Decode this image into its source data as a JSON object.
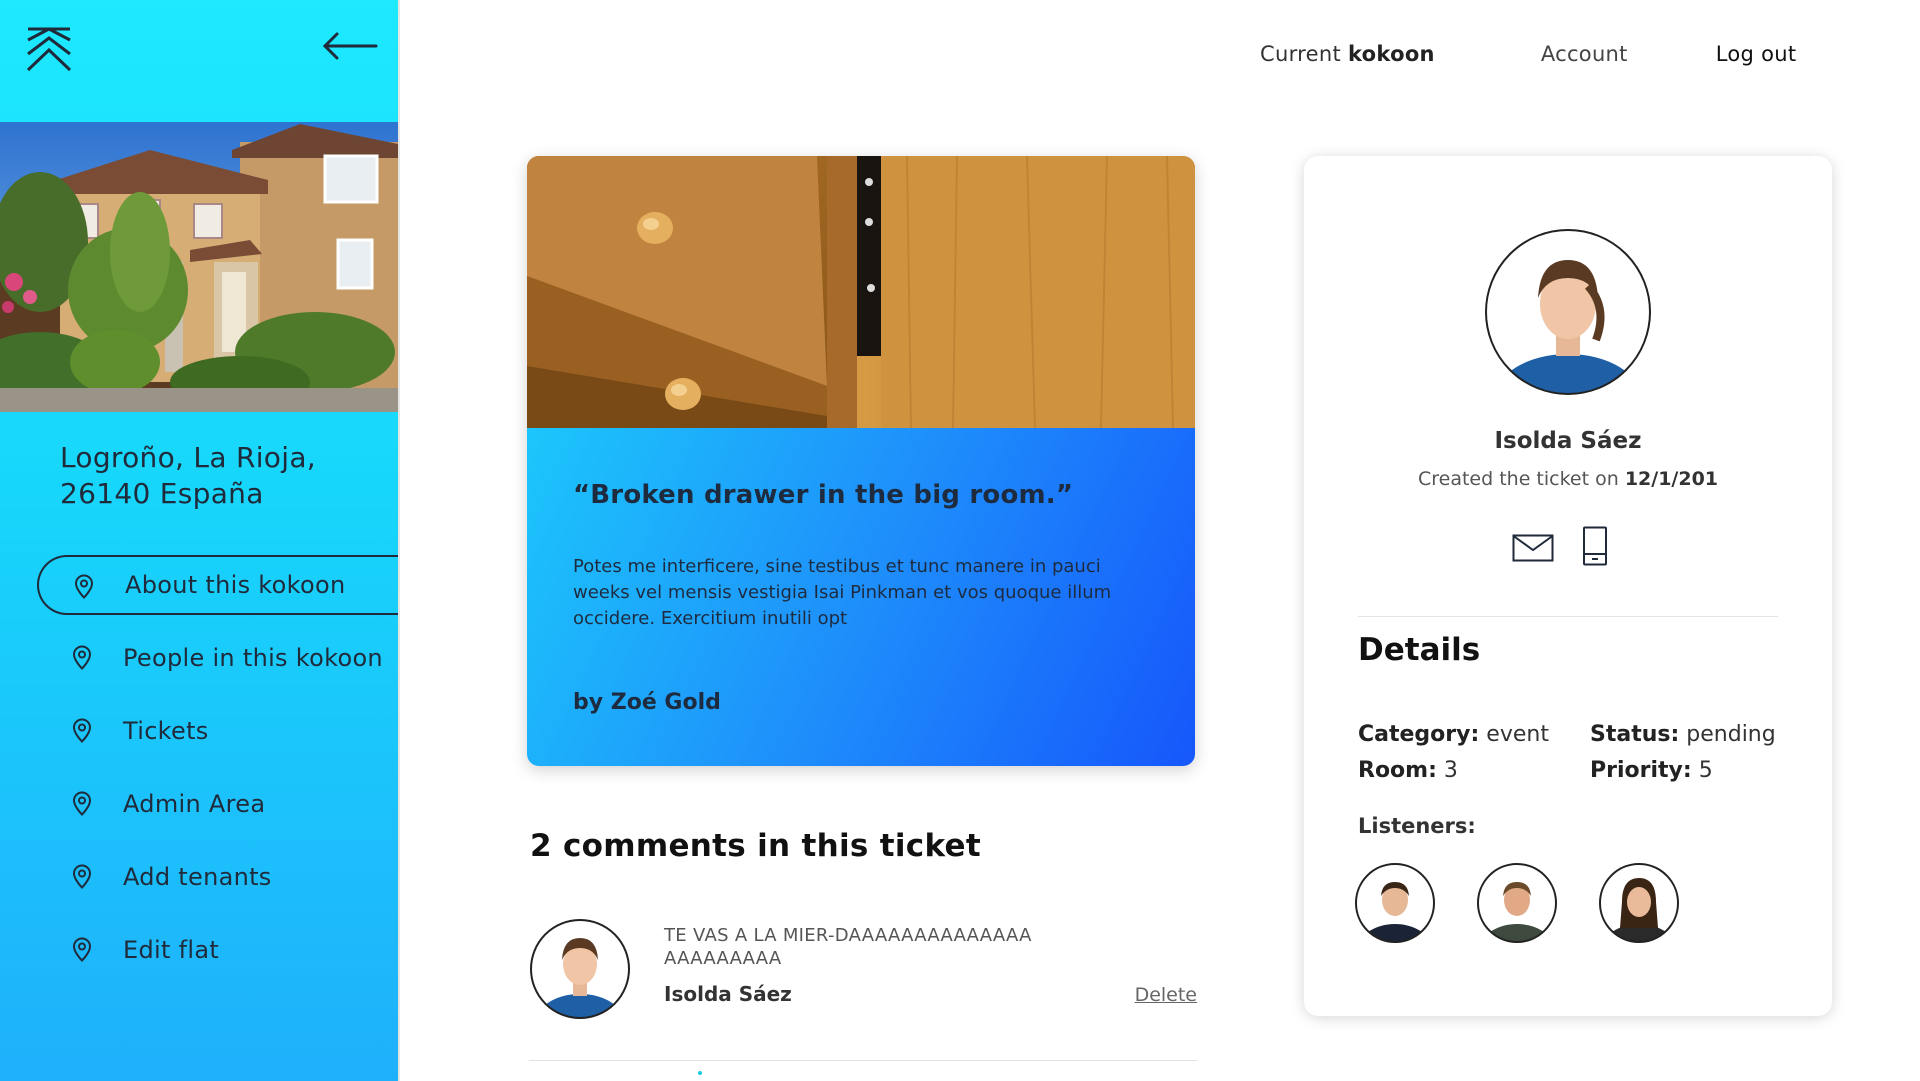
{
  "sidebar": {
    "address_line1": "Logroño, La Rioja,",
    "address_line2": "26140 España",
    "items": [
      {
        "label": "About this kokoon",
        "active": true
      },
      {
        "label": "People in this kokoon"
      },
      {
        "label": "Tickets"
      },
      {
        "label": "Admin Area"
      },
      {
        "label": "Add tenants"
      },
      {
        "label": "Edit flat"
      }
    ],
    "icons": {
      "logo": "kokoon-logo-icon",
      "back": "arrow-left-icon",
      "item": "map-pin-icon"
    }
  },
  "header": {
    "current_prefix": "Current",
    "current_name": "kokoon",
    "account": "Account",
    "logout": "Log out"
  },
  "ticket": {
    "title": "“Broken drawer in the big room.”",
    "description": "Potes me interficere, sine testibus et tunc manere in pauci weeks vel mensis vestigia Isai Pinkman et vos quoque illum occidere. Exercitium inutili opt",
    "author": "by Zoé Gold"
  },
  "comments": {
    "heading": "2 comments in this ticket",
    "items": [
      {
        "text": "TE VAS A LA MIER-DAAAAAAAAAAAAAAAAAAAAAAA",
        "author": "Isolda Sáez",
        "delete": "Delete"
      }
    ]
  },
  "creator": {
    "name": "Isolda Sáez",
    "created_prefix": "Created the ticket on",
    "created_date": "12/1/201",
    "icons": {
      "mail": "mail-icon",
      "phone": "phone-icon"
    }
  },
  "details": {
    "heading": "Details",
    "category_label": "Category:",
    "category_value": "event",
    "status_label": "Status:",
    "status_value": "pending",
    "room_label": "Room:",
    "room_value": "3",
    "priority_label": "Priority:",
    "priority_value": "5",
    "listeners_label": "Listeners:"
  },
  "colors": {
    "sidebar_top": "#1de9ff",
    "sidebar_bottom": "#1fb0fb",
    "ticket_gradient_start": "#1cc6fb",
    "ticket_gradient_end": "#1657fb",
    "text_dark": "#1e2b3f"
  }
}
